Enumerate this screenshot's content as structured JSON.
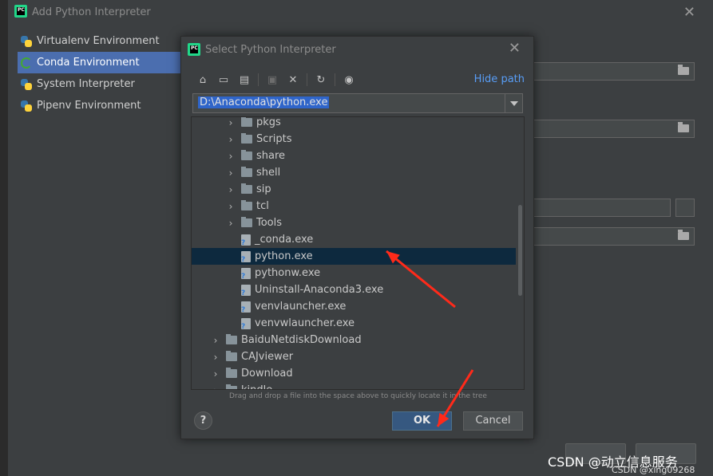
{
  "outer_dialog": {
    "title": "Add Python Interpreter",
    "environments": [
      {
        "label": "Virtualenv Environment",
        "icon": "python-icon"
      },
      {
        "label": "Conda Environment",
        "icon": "conda-icon",
        "selected": true
      },
      {
        "label": "System Interpreter",
        "icon": "python-icon"
      },
      {
        "label": "Pipenv Environment",
        "icon": "python-icon"
      }
    ]
  },
  "inner_dialog": {
    "title": "Select Python Interpreter",
    "hide_path": "Hide path",
    "path_value": "D:\\Anaconda\\python.exe",
    "tree": [
      {
        "label": "pkgs",
        "type": "folder",
        "level": 1,
        "expandable": true
      },
      {
        "label": "Scripts",
        "type": "folder",
        "level": 1,
        "expandable": true
      },
      {
        "label": "share",
        "type": "folder",
        "level": 1,
        "expandable": true
      },
      {
        "label": "shell",
        "type": "folder",
        "level": 1,
        "expandable": true
      },
      {
        "label": "sip",
        "type": "folder",
        "level": 1,
        "expandable": true
      },
      {
        "label": "tcl",
        "type": "folder",
        "level": 1,
        "expandable": true
      },
      {
        "label": "Tools",
        "type": "folder",
        "level": 1,
        "expandable": true
      },
      {
        "label": "_conda.exe",
        "type": "file",
        "level": 1
      },
      {
        "label": "python.exe",
        "type": "file",
        "level": 1,
        "selected": true
      },
      {
        "label": "pythonw.exe",
        "type": "file",
        "level": 1
      },
      {
        "label": "Uninstall-Anaconda3.exe",
        "type": "file",
        "level": 1
      },
      {
        "label": "venvlauncher.exe",
        "type": "file",
        "level": 1
      },
      {
        "label": "venvwlauncher.exe",
        "type": "file",
        "level": 1
      },
      {
        "label": "BaiduNetdiskDownload",
        "type": "folder",
        "level": 0,
        "expandable": true
      },
      {
        "label": "CAJviewer",
        "type": "folder",
        "level": 0,
        "expandable": true
      },
      {
        "label": "Download",
        "type": "folder",
        "level": 0,
        "expandable": true
      },
      {
        "label": "kindle",
        "type": "folder",
        "level": 0,
        "expandable": true
      }
    ],
    "hint": "Drag and drop a file into the space above to quickly locate it in the tree",
    "ok_label": "OK",
    "cancel_label": "Cancel",
    "help_label": "?"
  },
  "watermark": {
    "line1": "CSDN @动立信息服务",
    "line2": "CSDN @xing09268"
  },
  "colors": {
    "selection_accent": "#4b6eaf",
    "link": "#589df6",
    "annotation_arrow": "#ff2a1a"
  }
}
